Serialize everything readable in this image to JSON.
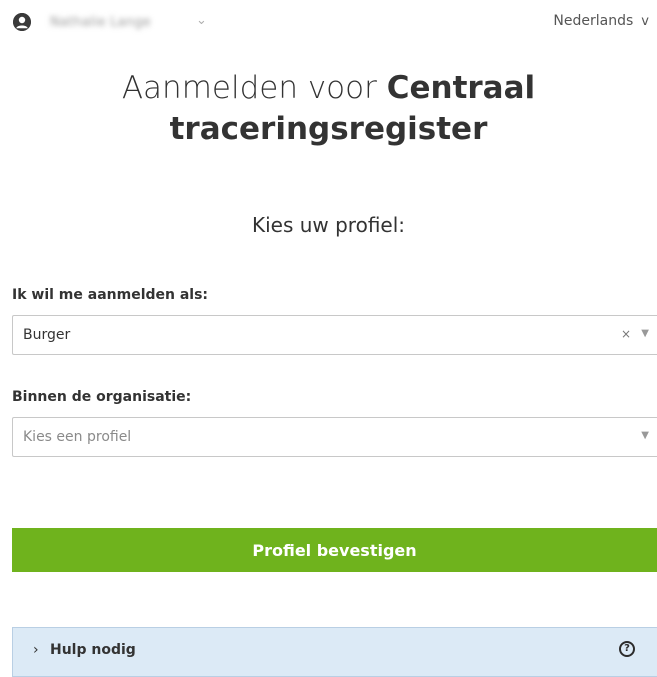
{
  "header": {
    "user_name": "Nathalie Lange",
    "user_chevron": "⌄",
    "language": "Nederlands",
    "language_chevron": "v"
  },
  "title": {
    "prefix": "Aanmelden voor",
    "bold_line1": "Centraal",
    "bold_line2": "traceringsregister"
  },
  "subtitle": "Kies uw profiel:",
  "form": {
    "role_label": "Ik wil me aanmelden als:",
    "role_value": "Burger",
    "role_clear": "×",
    "role_arrow": "▼",
    "org_label": "Binnen de organisatie:",
    "org_placeholder": "Kies een profiel",
    "org_arrow": "▼",
    "confirm_label": "Profiel bevestigen"
  },
  "help": {
    "chevron": "›",
    "label": "Hulp nodig",
    "icon_glyph": "?"
  },
  "colors": {
    "primary_button": "#6fb31d",
    "help_panel_bg": "#dceaf6"
  },
  "icons": {
    "user": "user-circle-icon",
    "help": "question-circle-icon"
  }
}
